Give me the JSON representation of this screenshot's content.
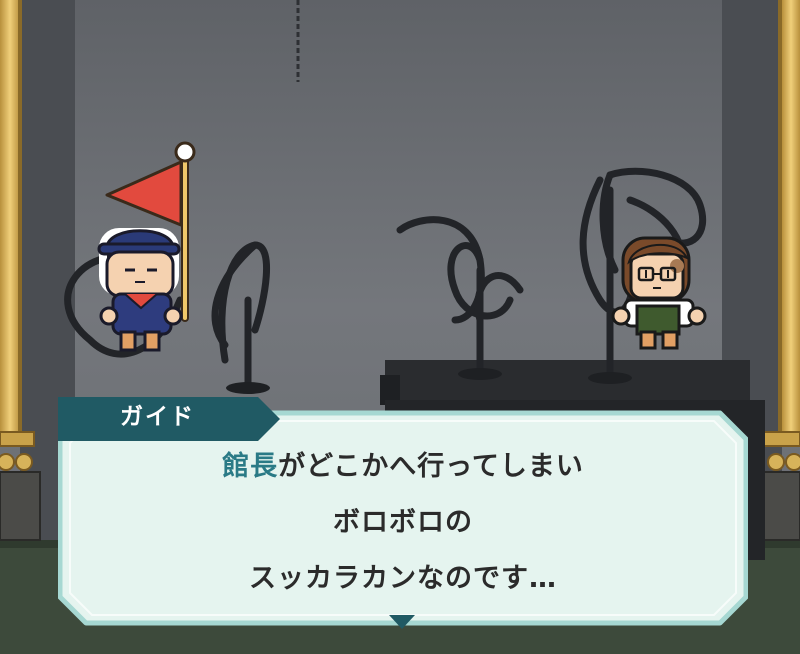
{
  "dialog": {
    "speaker": "ガイド",
    "line1_highlight": "館長",
    "line1_rest": "がどこかへ行ってしまい",
    "line2": "ボロボロの",
    "line3": "スッカラカンなのです…"
  },
  "colors": {
    "wall": "#707378",
    "floor": "#3b4a3a",
    "pillar": "#d9b45a",
    "dialog_bg": "#e5f4ef",
    "dialog_border": "#a6d8d2",
    "nameplate": "#205a64",
    "highlight_text": "#2a7a86",
    "flag": "#e24a3e"
  },
  "characters": [
    {
      "role": "guide",
      "icon": "guide-with-flag"
    },
    {
      "role": "visitor",
      "icon": "girl-with-glasses"
    }
  ],
  "icons": [
    "advance-arrow-icon",
    "flag-icon"
  ]
}
